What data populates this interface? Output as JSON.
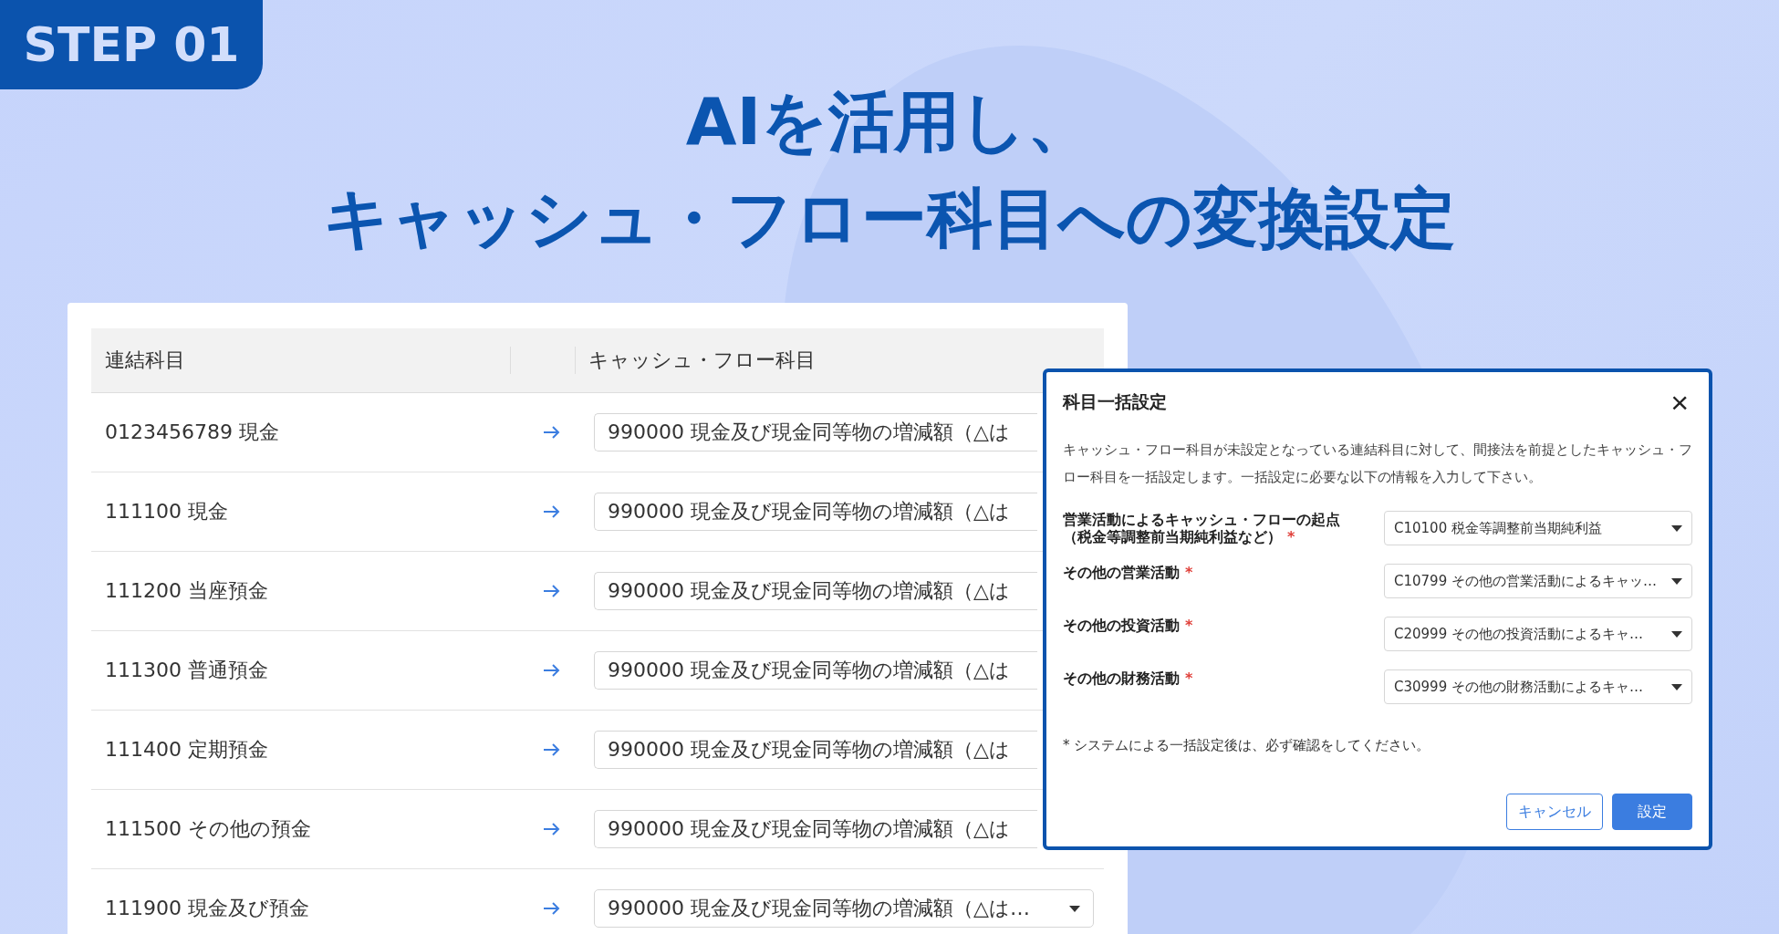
{
  "banner": {
    "step": "STEP 01",
    "title_lines": [
      "AIを活用し、",
      "キャッシュ・フロー科目への変換設定"
    ]
  },
  "table": {
    "columns": [
      "連結科目",
      "キャッシュ・フロー科目"
    ],
    "rows": [
      {
        "account": "0123456789 現金",
        "cf_account": "990000 現金及び現金同等物の増減額（△は",
        "caret_visible": false
      },
      {
        "account": "111100 現金",
        "cf_account": "990000 現金及び現金同等物の増減額（△は",
        "caret_visible": false
      },
      {
        "account": "111200 当座預金",
        "cf_account": "990000 現金及び現金同等物の増減額（△は",
        "caret_visible": false
      },
      {
        "account": "111300 普通預金",
        "cf_account": "990000 現金及び現金同等物の増減額（△は",
        "caret_visible": false
      },
      {
        "account": "111400 定期預金",
        "cf_account": "990000 現金及び現金同等物の増減額（△は",
        "caret_visible": false
      },
      {
        "account": "111500 その他の預金",
        "cf_account": "990000 現金及び現金同等物の増減額（△は",
        "caret_visible": false
      },
      {
        "account": "111900 現金及び預金",
        "cf_account": "990000 現金及び現金同等物の増減額（△は…",
        "caret_visible": true
      }
    ]
  },
  "dialog": {
    "title": "科目一括設定",
    "close": "×",
    "description": "キャッシュ・フロー科目が未設定となっている連結科目に対して、間接法を前提としたキャッシュ・フロー科目を一括設定します。一括設定に必要な以下の情報を入力して下さい。",
    "fields": [
      {
        "label_lines": [
          "営業活動によるキャッシュ・フローの起点",
          "（税金等調整前当期純利益など）"
        ],
        "required": true,
        "value": "C10100 税金等調整前当期純利益"
      },
      {
        "label_lines": [
          "その他の営業活動"
        ],
        "required": true,
        "value": "C10799 その他の営業活動によるキャッ…"
      },
      {
        "label_lines": [
          "その他の投資活動"
        ],
        "required": true,
        "value": "C20999 その他の投資活動によるキャ…"
      },
      {
        "label_lines": [
          "その他の財務活動"
        ],
        "required": true,
        "value": "C30999 その他の財務活動によるキャ…"
      }
    ],
    "required_mark": "*",
    "note": "* システムによる一括設定後は、必ず確認をしてください。",
    "buttons": [
      {
        "label": "キャンセル",
        "kind": "secondary"
      },
      {
        "label": "設定",
        "kind": "primary"
      }
    ]
  }
}
